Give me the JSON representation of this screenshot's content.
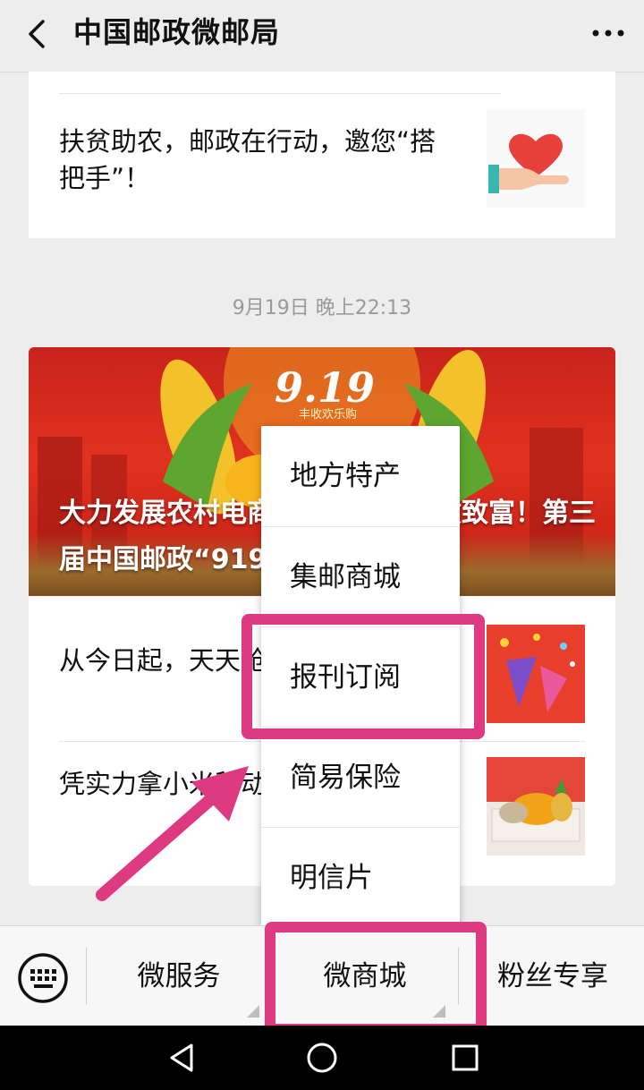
{
  "header": {
    "title": "中国邮政微邮局",
    "back_icon": "chevron-left-icon",
    "more_icon": "more-horizontal-icon"
  },
  "feed": {
    "article_top": {
      "title": "扶贫助农，邮政在行动，邀您“搭把手”！",
      "thumb_icon": "heart-in-hand-icon"
    },
    "timestamp": "9月19日 晚上22:13",
    "main_card": {
      "banner_logo": "9.19",
      "banner_logo_sub": "丰收欢乐购",
      "banner_title": "大力发展农村电商，助力农民增收致富！第三届中国邮政“919电商节”在…",
      "items": [
        {
          "title": "从今日起，天天抢…",
          "thumb_icon": "party-popper-icon"
        },
        {
          "title": "凭实力拿小米移动…机会",
          "thumb_icon": "fruit-basket-icon"
        }
      ]
    }
  },
  "popup_menu": {
    "items": [
      "地方特产",
      "集邮商城",
      "报刊订阅",
      "简易保险",
      "明信片"
    ],
    "highlighted_index": 2
  },
  "bottom_bar": {
    "keyboard_icon": "keyboard-icon",
    "tabs": [
      "微服务",
      "微商城",
      "粉丝专享"
    ],
    "highlighted_tab_index": 1
  },
  "annotation": {
    "highlight_color": "#dd3a82",
    "arrow_icon": "pointer-arrow-icon"
  },
  "system_nav": {
    "icons": [
      "nav-back-icon",
      "nav-home-icon",
      "nav-recent-icon"
    ]
  }
}
